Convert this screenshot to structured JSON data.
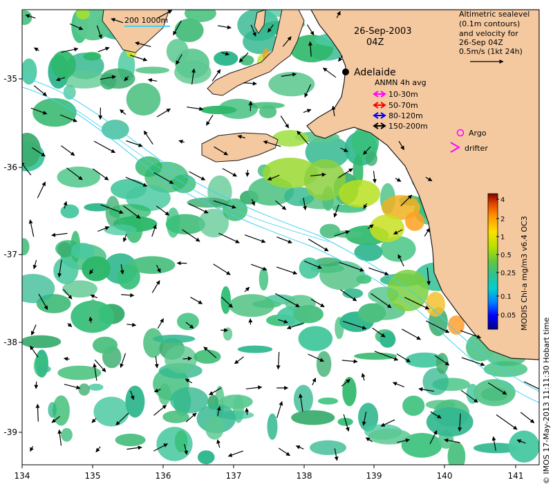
{
  "map": {
    "date": "26-Sep-2003",
    "time": "04Z",
    "scale_label": "200  1000m",
    "colors": {
      "land": "#f5c9a0",
      "coast": "#1a1a1a",
      "contour": "#3fd0f0",
      "background": "#ffffff"
    }
  },
  "axes": {
    "x_ticks": [
      "134",
      "135",
      "136",
      "137",
      "138",
      "139",
      "140",
      "141"
    ],
    "y_ticks": [
      "-35",
      "-36",
      "-37",
      "-38",
      "-39"
    ]
  },
  "places": {
    "adelaide": "Adelaide"
  },
  "legend": {
    "altimetry": {
      "lines": [
        "Altimetric sealevel",
        "(0.1m contours)",
        "and velocity for",
        "26-Sep 04Z",
        "0.5m/s (1kt 24h)"
      ]
    },
    "anmn": {
      "title": "ANMN 4h avg",
      "items": [
        {
          "label": "10-30m",
          "color": "#ff00ff"
        },
        {
          "label": "50-70m",
          "color": "#ff0000"
        },
        {
          "label": "80-120m",
          "color": "#0000ff"
        },
        {
          "label": "150-200m",
          "color": "#000000"
        }
      ]
    },
    "argo": {
      "label": "Argo",
      "color": "#ff00ff"
    },
    "drifter": {
      "label": "drifter",
      "color": "#ff00ff"
    }
  },
  "colorbar": {
    "title": "MODIS Chl-a mg/m3 v6.4 OC3",
    "ticks": [
      "4",
      "2",
      "1",
      "0.5",
      "0.25",
      "0.1",
      "0.05"
    ],
    "colors": [
      "#000080",
      "#0000ff",
      "#0080ff",
      "#00d0d0",
      "#30c090",
      "#60c840",
      "#b0e000",
      "#ffe000",
      "#ff9000",
      "#e04000",
      "#800000"
    ]
  },
  "credit": "© IMOS 17-May-2013 11:11:30 Hobart time"
}
